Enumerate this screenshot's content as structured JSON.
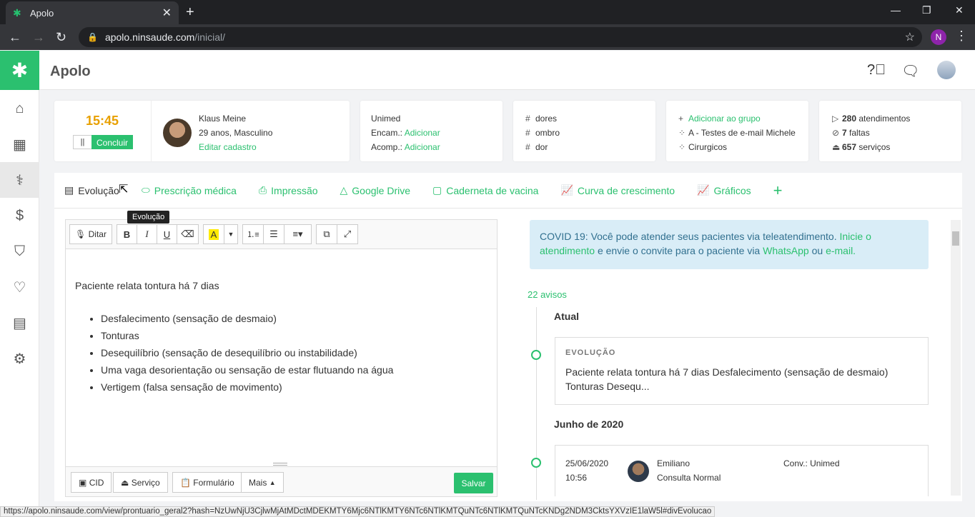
{
  "browser": {
    "tab_title": "Apolo",
    "url_host": "apolo.ninsaude.com",
    "url_path": "/inicial/",
    "profile_initial": "N",
    "status_url": "https://apolo.ninsaude.com/view/prontuario_geral2?hash=NzUwNjU3CjlwMjAtMDctMDEKMTY6Mjc6NTlKMTY6NTc6NTlKMTQuNTc6NTlKMTQuNTcKNDg2NDM3CktsYXVzIE1laW5l#divEvolucao"
  },
  "app": {
    "title": "Apolo",
    "accent": "#2bc06f"
  },
  "session": {
    "time": "15:45",
    "pause_label": "||",
    "concluir_label": "Concluir"
  },
  "patient": {
    "name": "Klaus Meine",
    "info": "29 anos, Masculino",
    "edit_label": "Editar cadastro"
  },
  "insurance": {
    "plan": "Unimed",
    "encam_label": "Encam.:",
    "encam_link": "Adicionar",
    "acomp_label": "Acomp.:",
    "acomp_link": "Adicionar"
  },
  "tags": [
    "dores",
    "ombro",
    "dor"
  ],
  "groups": {
    "add_label": "Adicionar ao grupo",
    "items": [
      "A - Testes de e-mail Michele",
      "Cirurgicos"
    ]
  },
  "stats": [
    {
      "value": "280",
      "label": "atendimentos"
    },
    {
      "value": "7",
      "label": "faltas"
    },
    {
      "value": "657",
      "label": "serviços"
    }
  ],
  "tabs": [
    "Evolução",
    "Prescrição médica",
    "Impressão",
    "Google Drive",
    "Caderneta de vacina",
    "Curva de crescimento",
    "Gráficos"
  ],
  "tooltip": "Evolução",
  "editor": {
    "ditar_label": "Ditar",
    "paragraph": "Paciente relata tontura há 7 dias",
    "bullets": [
      "Desfalecimento (sensação de desmaio)",
      "Tonturas",
      "Desequilíbrio (sensação de desequilíbrio ou instabilidade)",
      "Uma vaga desorientação ou sensação de estar flutuando na água",
      "Vertigem (falsa sensação de movimento)"
    ],
    "footer": {
      "cid": "CID",
      "servico": "Serviço",
      "formulario": "Formulário",
      "mais": "Mais",
      "salvar": "Salvar"
    }
  },
  "covid": {
    "text1": "COVID 19: Você pode atender seus pacientes via teleatendimento.",
    "link1": "Inicie o atendimento",
    "text2": "e envie o convite para o paciente via",
    "link2": "WhatsApp",
    "text3": "ou",
    "link3": "e-mail."
  },
  "timeline": {
    "avisos": "22 avisos",
    "current_heading": "Atual",
    "current_card": {
      "label": "EVOLUÇÃO",
      "text": "Paciente relata tontura há 7 dias Desfalecimento (sensação de desmaio) Tonturas Desequ..."
    },
    "month_heading": "Junho de 2020",
    "entry": {
      "date": "25/06/2020",
      "time": "10:56",
      "doctor": "Emiliano",
      "type": "Consulta Normal",
      "conv_label": "Conv.:",
      "conv": "Unimed"
    }
  }
}
